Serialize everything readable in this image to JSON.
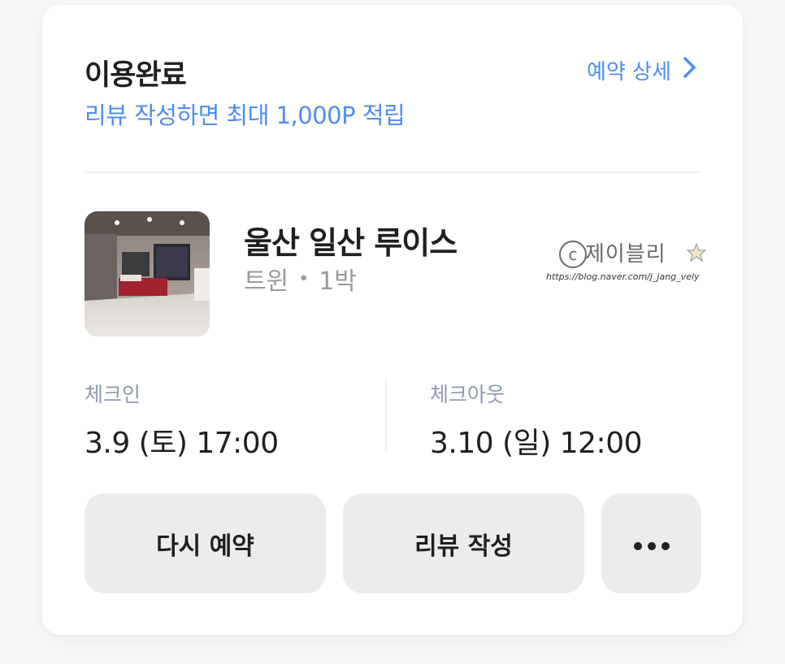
{
  "status": {
    "title": "이용완료",
    "promo": "리뷰 작성하면 최대 1,000P 적립"
  },
  "detail_link": {
    "label": "예약 상세",
    "icon": "chevron-right-icon"
  },
  "hotel": {
    "name": "울산 일산 루이스",
    "room_type": "트윈",
    "separator": "•",
    "nights": "1박"
  },
  "watermark": {
    "name": "제이블리",
    "url": "https://blog.naver.com/j_jang_vely"
  },
  "checkin": {
    "label": "체크인",
    "value": "3.9 (토) 17:00"
  },
  "checkout": {
    "label": "체크아웃",
    "value": "3.10 (일) 12:00"
  },
  "buttons": {
    "rebook": "다시 예약",
    "review": "리뷰 작성",
    "more_icon": "more-dots-icon"
  },
  "colors": {
    "accent": "#4d8ef0",
    "label": "#8c9ab0",
    "button_bg": "#ececec"
  }
}
